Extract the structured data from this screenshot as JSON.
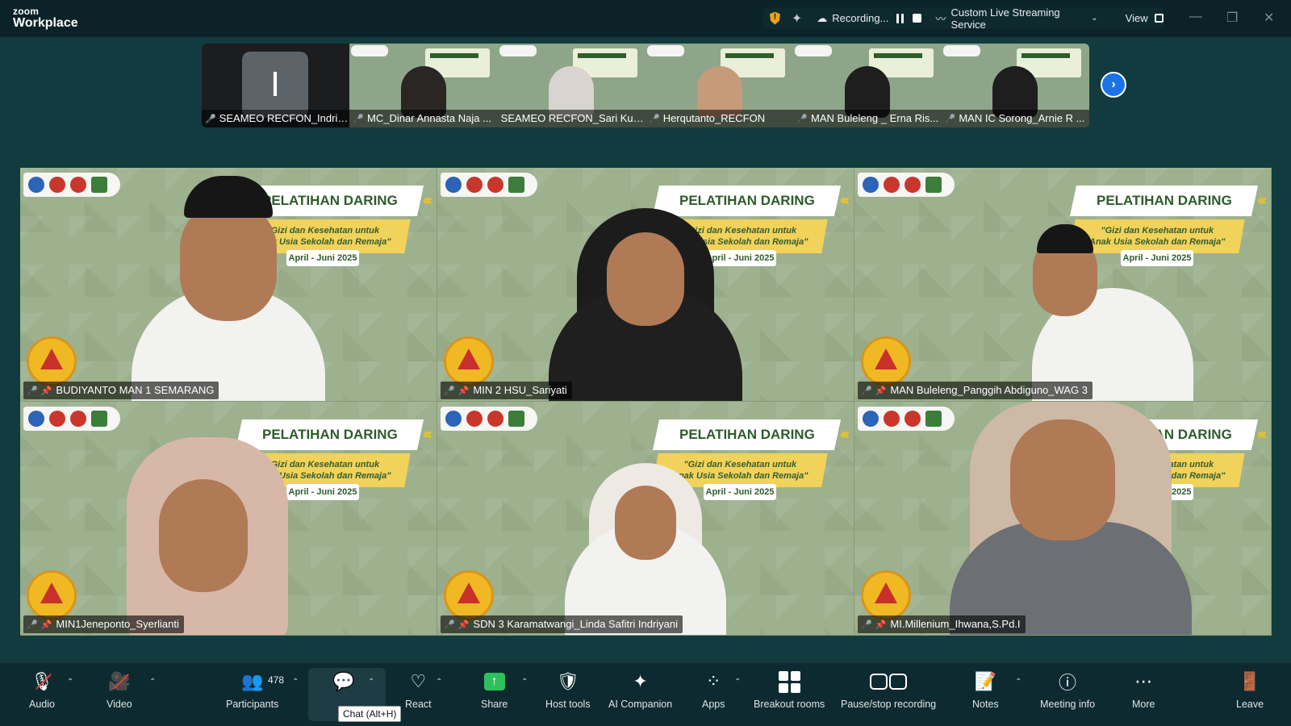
{
  "app": {
    "brand_top": "zoom",
    "brand_bottom": "Workplace"
  },
  "titlebar": {
    "recording_label": "Recording...",
    "stream_label": "Custom Live Streaming Service",
    "view_label": "View"
  },
  "filmstrip": [
    {
      "initial": "I",
      "name": "SEAMEO RECFON_Indriy..."
    },
    {
      "name": "MC_Dinar Annasta Naja ..."
    },
    {
      "name": "SEAMEO RECFON_Sari Kusu..."
    },
    {
      "name": "Herqutanto_RECFON"
    },
    {
      "name": "MAN Buleleng _ Erna Ris..."
    },
    {
      "name": "MAN IC Sorong_Arnie R ..."
    }
  ],
  "banner": {
    "title": "PELATIHAN DARING",
    "subtitle_line1": "\"Gizi dan Kesehatan untuk",
    "subtitle_line2": "Anak Usia Sekolah dan Remaja\"",
    "date": "April - Juni 2025",
    "arrows": "‹‹‹"
  },
  "gallery": [
    {
      "name": "BUDIYANTO MAN 1 SEMARANG"
    },
    {
      "name": "MIN 2 HSU_Sariyati"
    },
    {
      "name": "MAN Buleleng_Panggih Abdiguno_WAG 3"
    },
    {
      "name": "MIN1Jeneponto_Syerlianti"
    },
    {
      "name": "SDN 3 Karamatwangi_Linda Safitri Indriyani"
    },
    {
      "name": "MI.Millenium_Ihwana,S.Pd.I"
    }
  ],
  "toolbar": {
    "audio": "Audio",
    "video": "Video",
    "participants": "Participants",
    "participants_count": "478",
    "chat_tooltip": "Chat (Alt+H)",
    "react": "React",
    "share": "Share",
    "host_tools": "Host tools",
    "ai_companion": "AI Companion",
    "apps": "Apps",
    "breakout_rooms": "Breakout rooms",
    "pause_stop_recording": "Pause/stop recording",
    "notes": "Notes",
    "meeting_info": "Meeting info",
    "more": "More",
    "leave": "Leave"
  }
}
